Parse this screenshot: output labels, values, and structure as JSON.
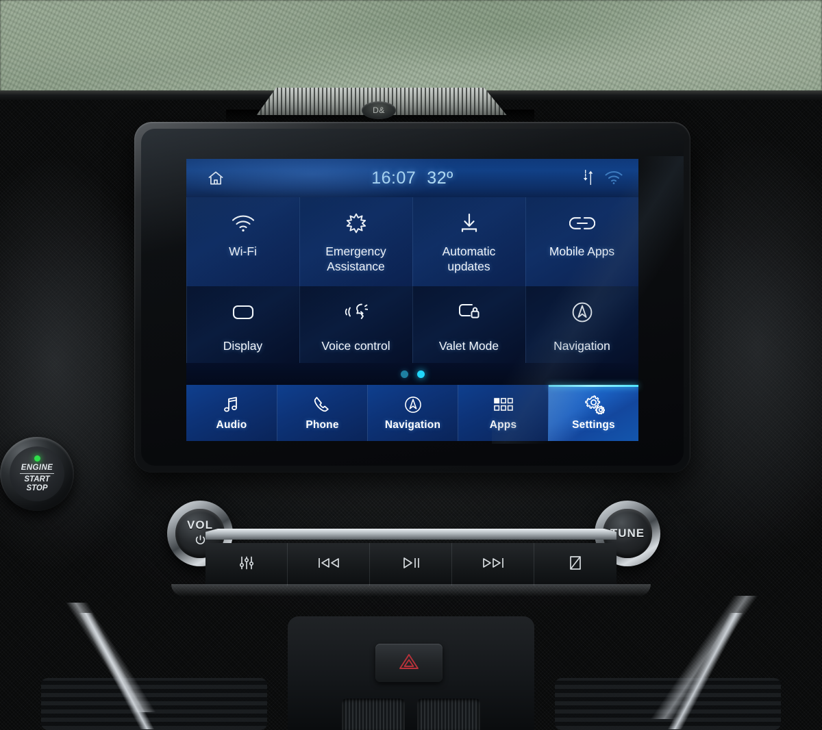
{
  "status_bar": {
    "home_icon": "home-icon",
    "time": "16:07",
    "temperature": "32º",
    "data_icon": "data-transfer-icon",
    "wifi_icon": "wifi-icon"
  },
  "settings_grid": {
    "page_indicator": {
      "total": 2,
      "active": 2
    },
    "tiles": [
      {
        "label": "Wi-Fi",
        "icon": "wifi-icon",
        "row": 1
      },
      {
        "label": "Emergency\nAssistance",
        "icon": "medical-star-icon",
        "row": 1,
        "line1": "Emergency",
        "line2": "Assistance"
      },
      {
        "label": "Automatic\nupdates",
        "icon": "download-icon",
        "row": 1,
        "line1": "Automatic",
        "line2": "updates"
      },
      {
        "label": "Mobile Apps",
        "icon": "link-icon",
        "row": 1
      },
      {
        "label": "Display",
        "icon": "screen-icon",
        "row": 2
      },
      {
        "label": "Voice control",
        "icon": "voice-head-icon",
        "row": 2
      },
      {
        "label": "Valet Mode",
        "icon": "screen-lock-icon",
        "row": 2
      },
      {
        "label": "Navigation",
        "icon": "compass-arrow-icon",
        "row": 2
      }
    ]
  },
  "nav_bar": {
    "items": [
      {
        "label": "Audio",
        "icon": "music-note-icon",
        "active": false
      },
      {
        "label": "Phone",
        "icon": "phone-handset-icon",
        "active": false
      },
      {
        "label": "Navigation",
        "icon": "compass-arrow-icon",
        "active": false
      },
      {
        "label": "Apps",
        "icon": "app-grid-icon",
        "active": false
      },
      {
        "label": "Settings",
        "icon": "gears-icon",
        "active": true
      }
    ]
  },
  "hardware": {
    "volume_knob": {
      "label": "VOL",
      "icon": "power-icon"
    },
    "tune_knob": {
      "label": "TUNE"
    },
    "media_buttons": [
      {
        "icon": "equalizer-icon",
        "name": "sound-settings-button"
      },
      {
        "icon": "previous-icon",
        "name": "previous-track-button"
      },
      {
        "icon": "play-pause-icon",
        "name": "play-pause-button"
      },
      {
        "icon": "next-icon",
        "name": "next-track-button"
      },
      {
        "icon": "eject-slash-icon",
        "name": "eject-button"
      }
    ],
    "engine_button": {
      "line1": "ENGINE",
      "line2": "START",
      "line3": "STOP",
      "led": "green"
    },
    "hazard_button": {
      "icon": "hazard-triangle-icon"
    },
    "sensor_badge": "D&"
  },
  "colors": {
    "accent_cyan": "#21d7fb",
    "nav_active_blue": "#1d6fd6",
    "status_bar_blue": "#114189",
    "tile_row1_blue": "#102f66",
    "tile_row2_blue": "#0a1c3e",
    "text_light": "#f1f6fc",
    "time_text": "#b9e4fb",
    "engine_led_green": "#2ee04a",
    "hazard_red": "#b8323a"
  }
}
